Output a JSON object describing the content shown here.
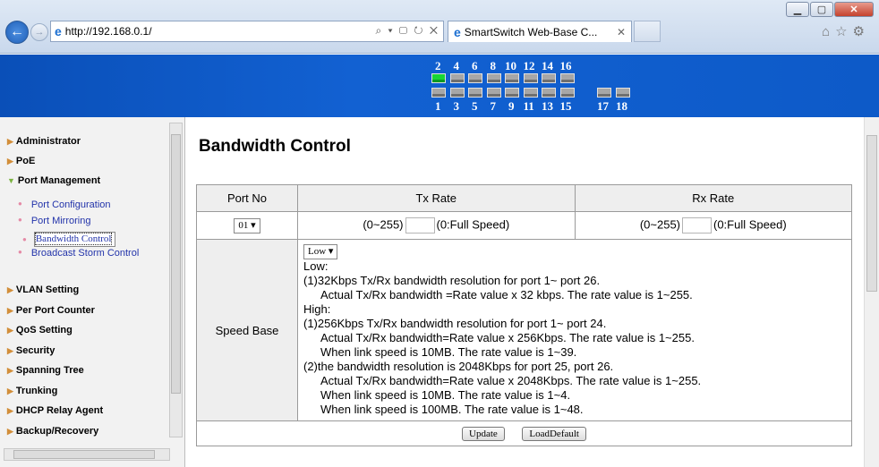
{
  "browser": {
    "url": "http://192.168.0.1/",
    "tab_title": "SmartSwitch Web-Base C...",
    "addr_tools": "⌕ ▾ ▢ ↻ ✕"
  },
  "banner": {
    "top_ports": [
      "2",
      "4",
      "6",
      "8",
      "10",
      "12",
      "14",
      "16"
    ],
    "bottom_ports": [
      "1",
      "3",
      "5",
      "7",
      "9",
      "11",
      "13",
      "15"
    ],
    "extra_ports": [
      "17",
      "18"
    ],
    "active_port": "2"
  },
  "sidebar": {
    "items": [
      {
        "label": "Administrator"
      },
      {
        "label": "PoE"
      },
      {
        "label": "Port Management"
      },
      {
        "label": "VLAN Setting"
      },
      {
        "label": "Per Port Counter"
      },
      {
        "label": "QoS Setting"
      },
      {
        "label": "Security"
      },
      {
        "label": "Spanning Tree"
      },
      {
        "label": "Trunking"
      },
      {
        "label": "DHCP Relay Agent"
      },
      {
        "label": "Backup/Recovery"
      }
    ],
    "sub_items": [
      {
        "label": "Port Configuration"
      },
      {
        "label": "Port Mirroring"
      },
      {
        "label": "Bandwidth Control"
      },
      {
        "label": "Broadcast Storm Control"
      }
    ]
  },
  "main": {
    "title": "Bandwidth Control",
    "headers": {
      "port_no": "Port No",
      "tx_rate": "Tx Rate",
      "rx_rate": "Rx Rate"
    },
    "port_select": "01",
    "tx_prefix": "(0~255)",
    "tx_suffix": "(0:Full Speed)",
    "rx_prefix": "(0~255)",
    "rx_suffix": "(0:Full Speed)",
    "speed_base_label": "Speed Base",
    "speed_base_select": "Low",
    "desc": {
      "l1": "Low:",
      "l2": "(1)32Kbps Tx/Rx bandwidth resolution for port 1~ port 26.",
      "l3": "Actual Tx/Rx bandwidth =Rate value x 32 kbps. The rate value is 1~255.",
      "l4": "High:",
      "l5": "(1)256Kbps Tx/Rx bandwidth resolution for port 1~ port 24.",
      "l6": "Actual Tx/Rx bandwidth=Rate value x 256Kbps. The rate value is 1~255.",
      "l7": "When link speed is 10MB. The rate value is 1~39.",
      "l8": "(2)the bandwidth resolution is 2048Kbps for port 25, port 26.",
      "l9": "Actual Tx/Rx bandwidth=Rate value x 2048Kbps. The rate value is 1~255.",
      "l10": "When link speed is 10MB. The rate value is 1~4.",
      "l11": "When link speed is 100MB. The rate value is 1~48."
    },
    "update_button": "Update",
    "load_default_button": "LoadDefault"
  }
}
